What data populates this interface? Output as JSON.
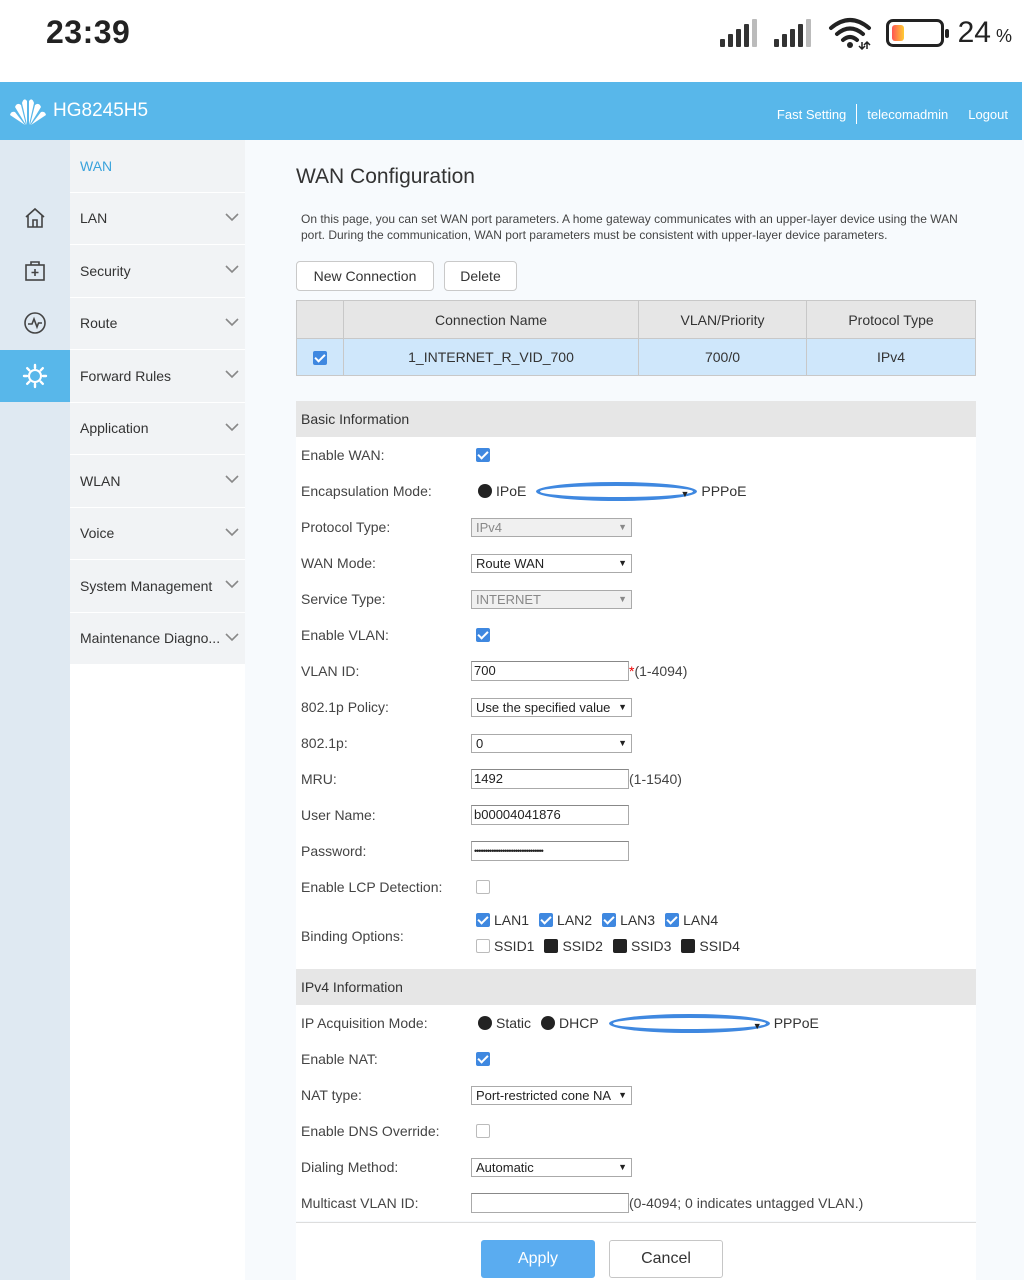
{
  "status_bar": {
    "time": "23:39",
    "battery_percent": "24",
    "battery_unit": "%",
    "battery_level": 0.24
  },
  "header": {
    "model": "HG8245H5",
    "links": [
      "Fast Setting",
      "telecomadmin",
      "Logout"
    ]
  },
  "rail": {
    "icons": [
      "home-icon",
      "medical-box-icon",
      "pulse-icon",
      "gear-icon"
    ],
    "active_index": 3
  },
  "menu": {
    "items": [
      "WAN",
      "LAN",
      "Security",
      "Route",
      "Forward Rules",
      "Application",
      "WLAN",
      "Voice",
      "System Management",
      "Maintenance Diagno..."
    ]
  },
  "page": {
    "title": "WAN Configuration",
    "description": "On this page, you can set WAN port parameters. A home gateway communicates with an upper-layer device using the WAN port. During the communication, WAN port parameters must be consistent with upper-layer device parameters.",
    "new_connection": "New Connection",
    "delete": "Delete"
  },
  "table": {
    "headers": [
      "Connection Name",
      "VLAN/Priority",
      "Protocol Type"
    ],
    "rows": [
      {
        "checked": true,
        "name": "1_INTERNET_R_VID_700",
        "vlan": "700/0",
        "protocol": "IPv4"
      }
    ]
  },
  "basic": {
    "section": "Basic Information",
    "enable_wan": "Enable WAN:",
    "encapsulation": "Encapsulation Mode:",
    "encap_ipoe": "IPoE",
    "encap_pppoe": "PPPoE",
    "protocol_type": "Protocol Type:",
    "protocol_value": "IPv4",
    "wan_mode": "WAN Mode:",
    "wan_mode_value": "Route WAN",
    "service_type": "Service Type:",
    "service_value": "INTERNET",
    "enable_vlan": "Enable VLAN:",
    "vlan_id": "VLAN ID:",
    "vlan_id_value": "700",
    "vlan_star": "*",
    "vlan_hint": "(1-4094)",
    "policy": "802.1p Policy:",
    "policy_value": "Use the specified value",
    "p8021": "802.1p:",
    "p8021_value": "0",
    "mru": "MRU:",
    "mru_value": "1492",
    "mru_hint": "(1-1540)",
    "user_name": "User Name:",
    "user_name_value": "b00004041876",
    "password": "Password:",
    "password_value": "••••••••••••••••••••••••••••••••",
    "lcp": "Enable LCP Detection:",
    "binding": "Binding Options:",
    "lan_options": [
      "LAN1",
      "LAN2",
      "LAN3",
      "LAN4"
    ],
    "ssid_options": [
      "SSID1",
      "SSID2",
      "SSID3",
      "SSID4"
    ]
  },
  "ipv4": {
    "section": "IPv4 Information",
    "acq_mode": "IP Acquisition Mode:",
    "acq_static": "Static",
    "acq_dhcp": "DHCP",
    "acq_pppoe": "PPPoE",
    "enable_nat": "Enable NAT:",
    "nat_type": "NAT type:",
    "nat_type_value": "Port-restricted cone NA",
    "dns_override": "Enable DNS Override:",
    "dialing": "Dialing Method:",
    "dialing_value": "Automatic",
    "mcast": "Multicast VLAN ID:",
    "mcast_value": "",
    "mcast_hint": "(0-4094; 0 indicates untagged VLAN.)"
  },
  "actions": {
    "apply": "Apply",
    "cancel": "Cancel"
  },
  "colors": {
    "header_blue": "#58b7ea",
    "checkbox_blue": "#3f88e0",
    "row_selected": "#cfe7fb"
  }
}
